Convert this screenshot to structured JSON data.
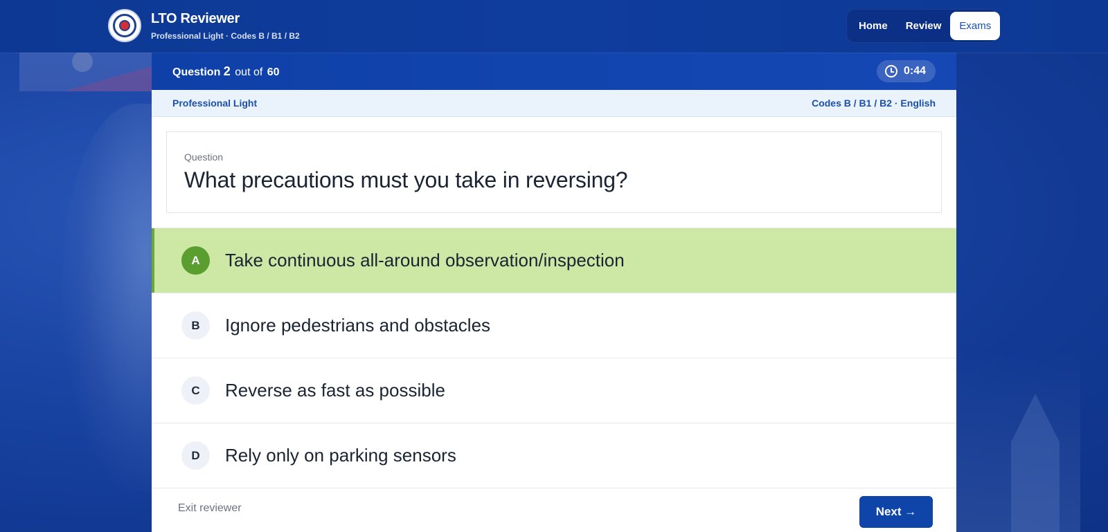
{
  "app": {
    "title": "LTO Reviewer",
    "subtitle": "Professional Light · Codes B / B1 / B2"
  },
  "nav": {
    "items": [
      {
        "label": "Home",
        "active": false
      },
      {
        "label": "Review",
        "active": false
      },
      {
        "label": "Exams",
        "active": true
      }
    ]
  },
  "quiz": {
    "question_word": "Question",
    "current": "2",
    "out_of_label": "out of",
    "total": "60",
    "timer": "0:44",
    "category": "Professional Light",
    "codes_language": "Codes B / B1 / B2 · English",
    "question_label": "Question",
    "question_text": "What precautions must you take in reversing?",
    "selected": "A",
    "choices": [
      {
        "letter": "A",
        "text": "Take continuous all-around observation/inspection"
      },
      {
        "letter": "B",
        "text": "Ignore pedestrians and obstacles"
      },
      {
        "letter": "C",
        "text": "Reverse as fast as possible"
      },
      {
        "letter": "D",
        "text": "Rely only on parking sensors"
      }
    ],
    "exit_label": "Exit reviewer",
    "next_label": "Next →"
  },
  "colors": {
    "primary": "#0f45a8",
    "selected_bg": "#cce8a4",
    "selected_badge": "#5a9e30"
  }
}
